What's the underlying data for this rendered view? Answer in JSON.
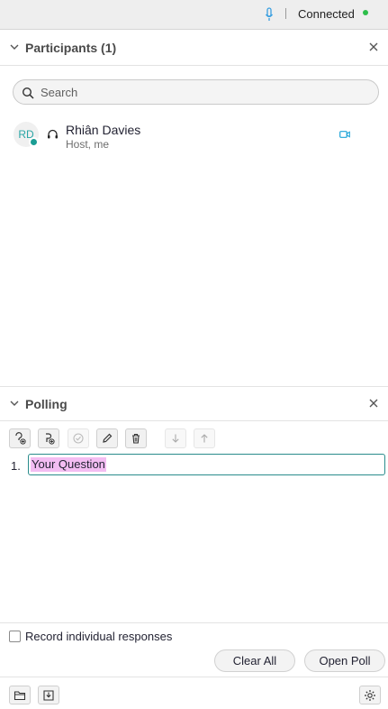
{
  "topbar": {
    "status": "Connected",
    "status_color": "#2dbe4a",
    "mic_icon": "microphone-icon"
  },
  "participants": {
    "title": "Participants (1)",
    "search_placeholder": "Search",
    "list": [
      {
        "initials": "RD",
        "name": "Rhiân Davies",
        "role": "Host, me",
        "audio_icon": "headset-icon",
        "video_icon": "camera-icon"
      }
    ]
  },
  "polling": {
    "title": "Polling",
    "toolbar_icons": [
      "add-question-icon",
      "add-answer-icon",
      "check-icon",
      "edit-icon",
      "delete-icon",
      "move-down-icon",
      "move-up-icon"
    ],
    "question_number": "1.",
    "question_text": "Your Question",
    "record_label": "Record individual responses",
    "clear_label": "Clear All",
    "open_label": "Open Poll"
  },
  "footer": {
    "icons": [
      "folder-icon",
      "save-poll-icon",
      "settings-icon"
    ]
  }
}
